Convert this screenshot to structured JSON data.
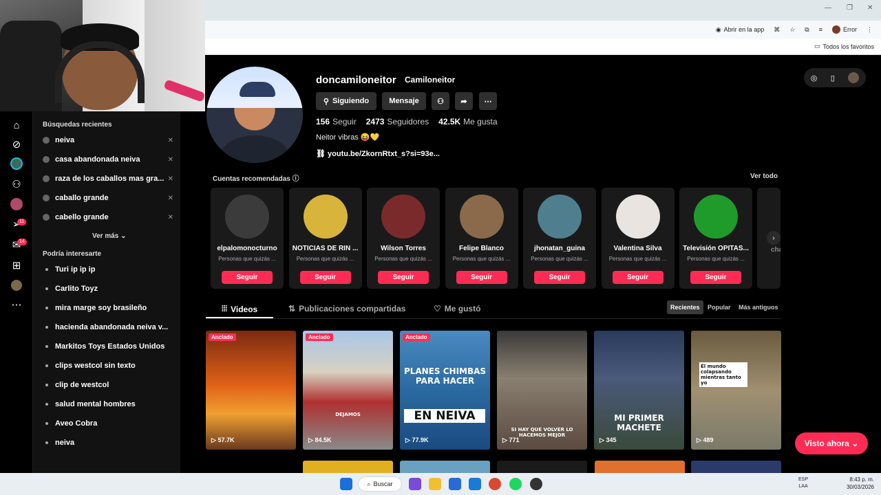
{
  "browser": {
    "open_in_app": "Abrir en la app",
    "profile_error": "Error",
    "bookmarks_label": "Todos los favoritos"
  },
  "rail": {
    "messages_badge": "11",
    "inbox_badge": "14"
  },
  "search_panel": {
    "recent_title": "Búsquedas recientes",
    "recent": [
      "neiva",
      "casa abandonada neiva",
      "raza de los caballos mas gra...",
      "caballo grande",
      "cabello grande"
    ],
    "see_more": "Ver más",
    "interest_title": "Podría interesarte",
    "suggestions": [
      "Turi ip ip ip",
      "Carlito Toyz",
      "mira marge soy brasileño",
      "hacienda abandonada neiva v...",
      "Markitos Toys Estados Unidos",
      "clips westcol sin texto",
      "clip de westcol",
      "salud mental hombres",
      "Aveo Cobra",
      "neiva"
    ]
  },
  "profile": {
    "username": "doncamiloneitor",
    "display_name": "Camiloneitor",
    "following_btn": "Siguiendo",
    "message_btn": "Mensaje",
    "following_count": "156",
    "following_label": "Seguir",
    "followers_count": "2473",
    "followers_label": "Seguidores",
    "likes_count": "42.5K",
    "likes_label": "Me gusta",
    "bio": "Neitor vibras 😝💛",
    "link": "youtu.be/ZkornRtxt_s?si=93e..."
  },
  "recommended": {
    "title": "Cuentas recomendadas",
    "see_all": "Ver todo",
    "follow_label": "Seguir",
    "subtitle": "Personas que quizás ...",
    "accounts": [
      {
        "name": "elpalomonocturno",
        "color": "#3b3b3b"
      },
      {
        "name": "NOTICIAS DE RIN ...",
        "color": "#d8b43a"
      },
      {
        "name": "Wilson Torres",
        "color": "#7a2a2a"
      },
      {
        "name": "Felipe Blanco",
        "color": "#8a6a4a"
      },
      {
        "name": "jhonatan_guina",
        "color": "#4f7f8f"
      },
      {
        "name": "Valentina Silva",
        "color": "#e9e4df"
      },
      {
        "name": "Televisión OPITAS...",
        "color": "#1f9b2b"
      }
    ],
    "partial_name": "chay"
  },
  "tabs": {
    "videos": "Videos",
    "shared": "Publicaciones compartidas",
    "liked": "Me gustó"
  },
  "sort": {
    "recent": "Recientes",
    "popular": "Popular",
    "oldest": "Más antiguos"
  },
  "videos": [
    {
      "pinned": "Anclado",
      "views": "57.7K",
      "bg": "linear-gradient(180deg,#7a2a10,#e06018 45%,#f0a030 70%,#6a3a20)"
    },
    {
      "pinned": "Anclado",
      "views": "84.5K",
      "bg": "linear-gradient(180deg,#a9c7e8,#d8d0c0 35%,#b03030 60%,#8a8a8a)",
      "caption": "DEJAMOS"
    },
    {
      "pinned": "Anclado",
      "views": "77.9K",
      "bg": "linear-gradient(180deg,#4a8ac0,#2a6aa0 50%,#1a4a80)",
      "caption": "PLANES CHIMBAS PARA HACER",
      "caption2": "EN NEIVA"
    },
    {
      "pinned": "",
      "views": "771",
      "bg": "linear-gradient(180deg,#3a3a3a,#8a8070 40%,#5a4a40)",
      "caption": "SI HAY QUE VOLVER LO HACEMOS MEJOR"
    },
    {
      "pinned": "",
      "views": "345",
      "bg": "linear-gradient(180deg,#2a3a5a,#4a5a7a 40%,#3a4a3a)",
      "caption": "MI PRIMER MACHETE"
    },
    {
      "pinned": "",
      "views": "489",
      "bg": "linear-gradient(180deg,#6a5a40,#a09070 50%,#7a7a6a)",
      "caption": "El mundo colapsando mientras tanto yo"
    }
  ],
  "watched_now": "Visto ahora",
  "taskbar": {
    "search": "Buscar",
    "lang": "ESP",
    "lang2": "LAA",
    "time": "8:43 p. m.",
    "date": "30/03/2026"
  }
}
